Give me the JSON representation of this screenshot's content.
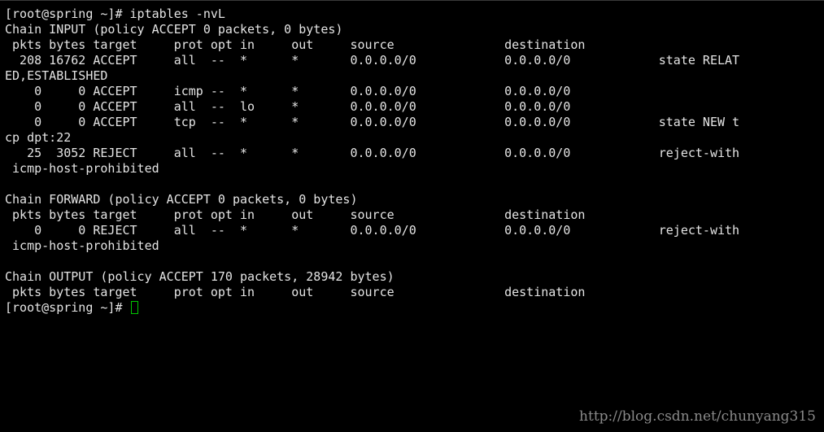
{
  "terminal": {
    "lines": [
      "[root@spring ~]# iptables -nvL",
      "Chain INPUT (policy ACCEPT 0 packets, 0 bytes)",
      " pkts bytes target     prot opt in     out     source               destination",
      "  208 16762 ACCEPT     all  --  *      *       0.0.0.0/0            0.0.0.0/0            state RELAT",
      "ED,ESTABLISHED",
      "    0     0 ACCEPT     icmp --  *      *       0.0.0.0/0            0.0.0.0/0",
      "    0     0 ACCEPT     all  --  lo     *       0.0.0.0/0            0.0.0.0/0",
      "    0     0 ACCEPT     tcp  --  *      *       0.0.0.0/0            0.0.0.0/0            state NEW t",
      "cp dpt:22",
      "   25  3052 REJECT     all  --  *      *       0.0.0.0/0            0.0.0.0/0            reject-with",
      " icmp-host-prohibited",
      "",
      "Chain FORWARD (policy ACCEPT 0 packets, 0 bytes)",
      " pkts bytes target     prot opt in     out     source               destination",
      "    0     0 REJECT     all  --  *      *       0.0.0.0/0            0.0.0.0/0            reject-with",
      " icmp-host-prohibited",
      "",
      "Chain OUTPUT (policy ACCEPT 170 packets, 28942 bytes)",
      " pkts bytes target     prot opt in     out     source               destination"
    ],
    "prompt": "[root@spring ~]# ",
    "watermark": "http://blog.csdn.net/chunyang315"
  },
  "colors": {
    "background": "#000000",
    "text": "#e4e4e4",
    "cursor": "#00c800",
    "watermark": "#8a8a8a"
  }
}
